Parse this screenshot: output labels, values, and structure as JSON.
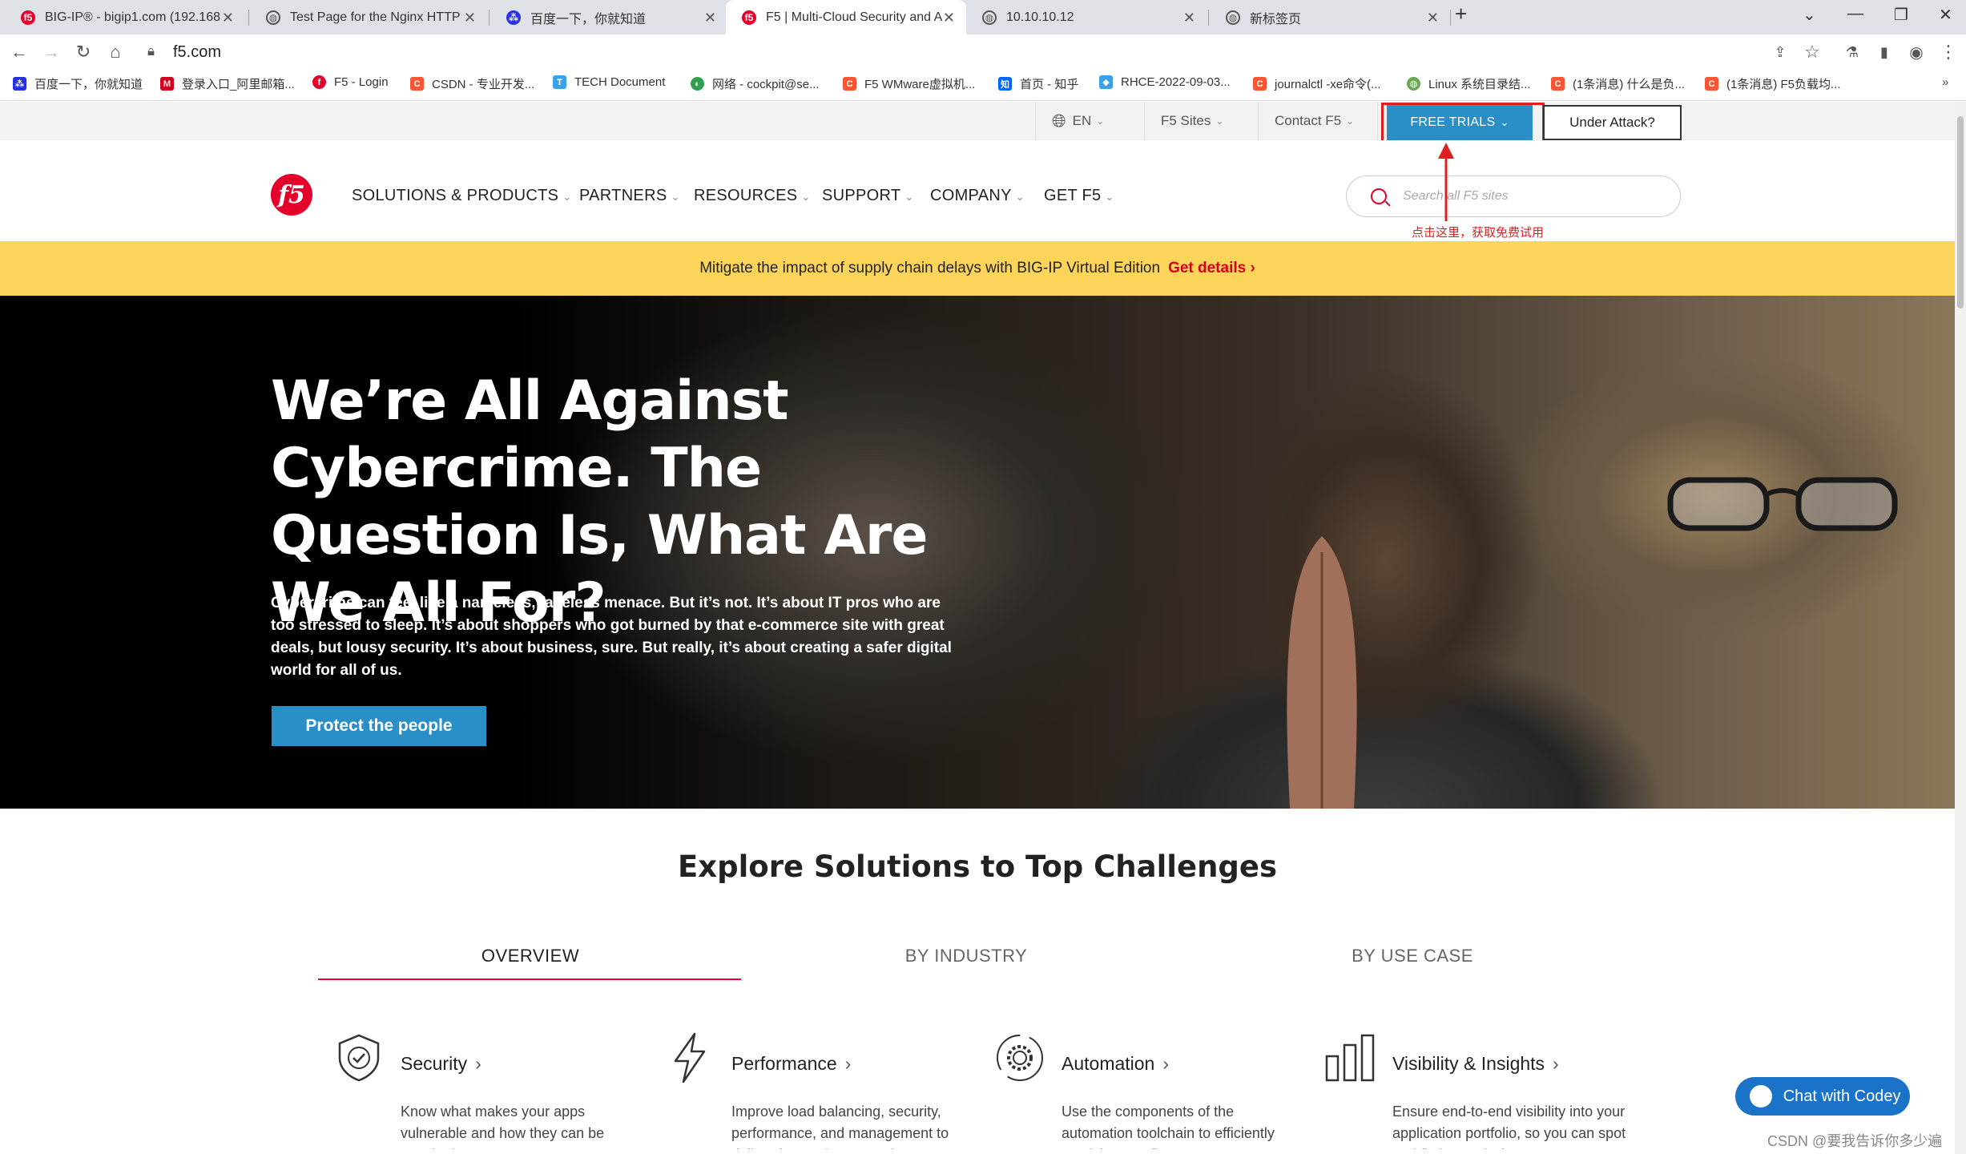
{
  "tabs": [
    {
      "title": "BIG-IP® - bigip1.com (192.168",
      "icon": "f5-logo-icon"
    },
    {
      "title": "Test Page for the Nginx HTTP",
      "icon": "globe-icon"
    },
    {
      "title": "百度一下，你就知道",
      "icon": "baidu-paw-icon"
    },
    {
      "title": "F5 | Multi-Cloud Security and A",
      "icon": "f5-logo-icon",
      "active": true
    },
    {
      "title": "10.10.10.12",
      "icon": "globe-icon"
    },
    {
      "title": "新标签页",
      "icon": "globe-icon"
    }
  ],
  "address": {
    "url": "f5.com"
  },
  "bookmarks": [
    {
      "label": "百度一下，你就知道",
      "color": "#2932e1"
    },
    {
      "label": "登录入口_阿里邮箱...",
      "color": "#d0021b"
    },
    {
      "label": "F5 - Login",
      "color": "#e4002b"
    },
    {
      "label": "CSDN - 专业开发...",
      "color": "#fc5531"
    },
    {
      "label": "TECH Document",
      "color": "#3aa0e8"
    },
    {
      "label": "网络 - cockpit@se...",
      "color": "#2e9e4f"
    },
    {
      "label": "F5 WMware虚拟机...",
      "color": "#fc5531"
    },
    {
      "label": "首页 - 知乎",
      "color": "#0066ff"
    },
    {
      "label": "RHCE-2022-09-03...",
      "color": "#3aa0e8"
    },
    {
      "label": "journalctl -xe命令(...",
      "color": "#fc5531"
    },
    {
      "label": "Linux 系统目录结...",
      "color": "#6aa84f"
    },
    {
      "label": "(1条消息) 什么是负...",
      "color": "#fc5531"
    },
    {
      "label": "(1条消息) F5负载均...",
      "color": "#fc5531"
    }
  ],
  "utility": {
    "language": "EN",
    "sites": "F5 Sites",
    "contact": "Contact F5",
    "free_trials": "FREE TRIALS",
    "under_attack": "Under Attack?",
    "annotation": "点击这里，获取免费试用"
  },
  "nav": {
    "logo": "f5",
    "items": [
      "SOLUTIONS & PRODUCTS",
      "PARTNERS",
      "RESOURCES",
      "SUPPORT",
      "COMPANY",
      "GET F5"
    ],
    "search_placeholder": "Search all F5 sites"
  },
  "promo": {
    "text": "Mitigate the impact of supply chain delays with BIG-IP Virtual Edition",
    "link": "Get details ›"
  },
  "hero": {
    "title": "We’re All Against Cybercrime. The Question Is, What Are We All For?",
    "body": "Cybercrime can feel like a nameless, faceless menace. But it’s not. It’s about IT pros who are too stressed to sleep. It’s about shoppers who got burned by that e-commerce site with great deals, but lousy security. It’s about business, sure. But really, it’s about creating a safer digital world for all of us.",
    "cta": "Protect the people"
  },
  "explore": {
    "title": "Explore Solutions to Top Challenges",
    "tabs": [
      "OVERVIEW",
      "BY INDUSTRY",
      "BY USE CASE"
    ],
    "cards": [
      {
        "title": "Security",
        "desc": "Know what makes your apps vulnerable and how they can be attacked, so you can put",
        "icon": "shield-check-icon"
      },
      {
        "title": "Performance",
        "desc": "Improve load balancing, security, performance, and management to deliver fast, uninterrupted",
        "icon": "lightning-bolt-icon"
      },
      {
        "title": "Automation",
        "desc": "Use the components of the automation toolchain to efficiently provision, configure",
        "icon": "gear-cycle-icon"
      },
      {
        "title": "Visibility & Insights",
        "desc": "Ensure end-to-end visibility into your application portfolio, so you can spot and fix issues before",
        "icon": "bar-chart-icon"
      }
    ]
  },
  "chat": {
    "label": "Chat with Codey"
  },
  "watermark": "CSDN @要我告诉你多少遍"
}
